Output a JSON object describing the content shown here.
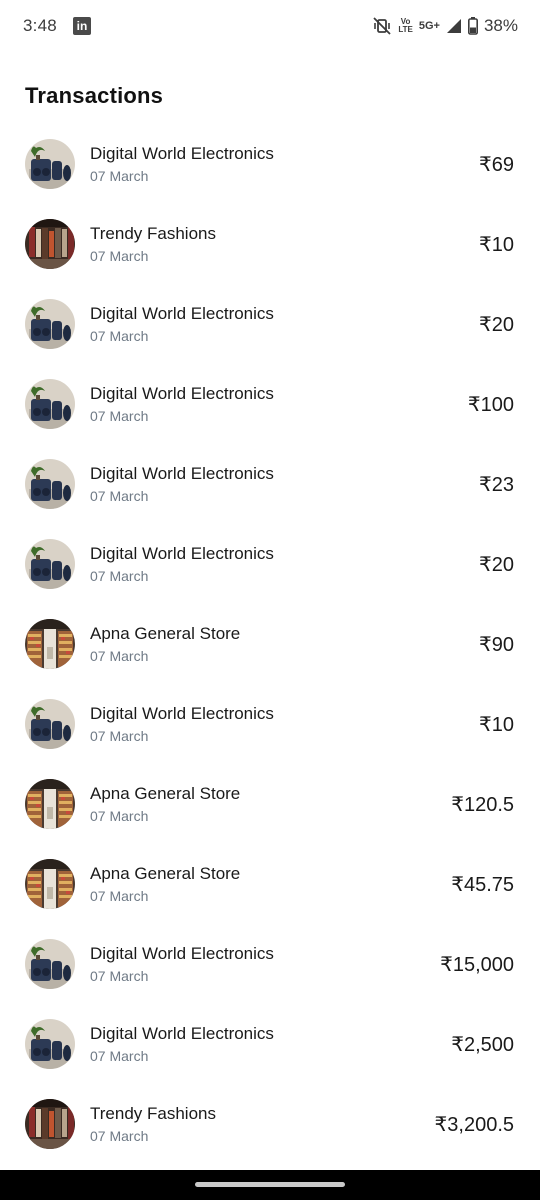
{
  "status_bar": {
    "time": "3:48",
    "app_icon": "linkedin-icon",
    "app_icon_text": "in",
    "network_top": "Vo",
    "network_bottom": "LTE",
    "network_gen": "5G+",
    "battery_percent": "38%"
  },
  "header": {
    "title": "Transactions"
  },
  "transactions": [
    {
      "merchant": "Digital World Electronics",
      "date": "07 March",
      "amount": "₹69",
      "avatar": "electronics"
    },
    {
      "merchant": "Trendy Fashions",
      "date": "07 March",
      "amount": "₹10",
      "avatar": "fashion"
    },
    {
      "merchant": "Digital World Electronics",
      "date": "07 March",
      "amount": "₹20",
      "avatar": "electronics"
    },
    {
      "merchant": "Digital World Electronics",
      "date": "07 March",
      "amount": "₹100",
      "avatar": "electronics"
    },
    {
      "merchant": "Digital World Electronics",
      "date": "07 March",
      "amount": "₹23",
      "avatar": "electronics"
    },
    {
      "merchant": "Digital World Electronics",
      "date": "07 March",
      "amount": "₹20",
      "avatar": "electronics"
    },
    {
      "merchant": "Apna General Store",
      "date": "07 March",
      "amount": "₹90",
      "avatar": "store"
    },
    {
      "merchant": "Digital World Electronics",
      "date": "07 March",
      "amount": "₹10",
      "avatar": "electronics"
    },
    {
      "merchant": "Apna General Store",
      "date": "07 March",
      "amount": "₹120.5",
      "avatar": "store"
    },
    {
      "merchant": "Apna General Store",
      "date": "07 March",
      "amount": "₹45.75",
      "avatar": "store"
    },
    {
      "merchant": "Digital World Electronics",
      "date": "07 March",
      "amount": "₹15,000",
      "avatar": "electronics"
    },
    {
      "merchant": "Digital World Electronics",
      "date": "07 March",
      "amount": "₹2,500",
      "avatar": "electronics"
    },
    {
      "merchant": "Trendy Fashions",
      "date": "07 March",
      "amount": "₹3,200.5",
      "avatar": "fashion"
    }
  ]
}
